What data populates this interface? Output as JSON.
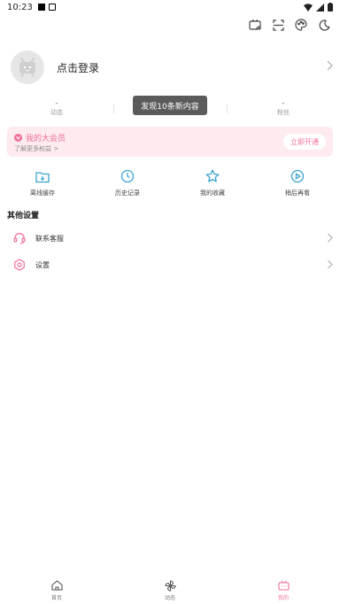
{
  "status_bar": {
    "time": "10:23"
  },
  "profile": {
    "login_text": "点击登录"
  },
  "stats": [
    {
      "value": "-",
      "label": "动态"
    },
    {
      "value": "-",
      "label": "关注"
    },
    {
      "value": "-",
      "label": "粉丝"
    }
  ],
  "toast": {
    "text": "发现10条新内容"
  },
  "vip": {
    "title": "我的大会员",
    "subtitle": "了解更多权益 >",
    "button": "立即开通"
  },
  "quick_actions": [
    {
      "label": "离线缓存",
      "icon": "offline-cache-icon"
    },
    {
      "label": "历史记录",
      "icon": "history-icon"
    },
    {
      "label": "我的收藏",
      "icon": "star-icon"
    },
    {
      "label": "稍后再看",
      "icon": "watch-later-icon"
    }
  ],
  "other_settings": {
    "title": "其他设置",
    "items": [
      {
        "label": "联系客服",
        "icon": "headset-icon"
      },
      {
        "label": "设置",
        "icon": "gear-icon"
      }
    ]
  },
  "bottom_nav": [
    {
      "label": "首页",
      "icon": "home-icon"
    },
    {
      "label": "动态",
      "icon": "pinwheel-icon"
    },
    {
      "label": "我的",
      "icon": "tv-icon",
      "active": true
    }
  ],
  "colors": {
    "accent": "#f0719a",
    "vip_bg": "#fdebef",
    "toast_bg": "#5b5b5b"
  }
}
